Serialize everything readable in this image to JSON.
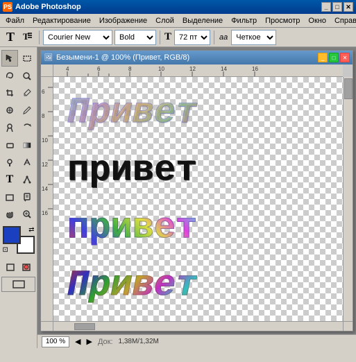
{
  "app": {
    "title": "Adobe Photoshop",
    "icon": "PS"
  },
  "menu": {
    "items": [
      "Файл",
      "Редактирование",
      "Изображение",
      "Слой",
      "Выделение",
      "Фильтр",
      "Просмотр",
      "Окно",
      "Справк..."
    ]
  },
  "toolbar": {
    "text_tool_label": "T",
    "paragraph_tool_label": "¶",
    "font_name": "Courier New",
    "font_style": "Bold",
    "font_size_icon": "T",
    "font_size": "72 пт",
    "aa_label": "aa",
    "anti_alias": "Четкое"
  },
  "document": {
    "title": "Безымени-1 @ 100% (Привет, RGB/8)",
    "icon": "🖼"
  },
  "canvas": {
    "texts": [
      {
        "content": "Привет",
        "style": "italic-chrome"
      },
      {
        "content": "привет",
        "style": "bold-black"
      },
      {
        "content": "привет",
        "style": "colorful"
      },
      {
        "content": "Привет",
        "style": "italic-colorful"
      }
    ]
  },
  "status": {
    "zoom": "100 %",
    "separator": "Док:",
    "doc_info": "1,38M/1,32M"
  },
  "ruler": {
    "h_labels": [
      "4",
      "6",
      "8",
      "10",
      "12",
      "14",
      "16"
    ],
    "v_labels": [
      "6",
      "8",
      "10",
      "12",
      "14",
      "16"
    ]
  }
}
